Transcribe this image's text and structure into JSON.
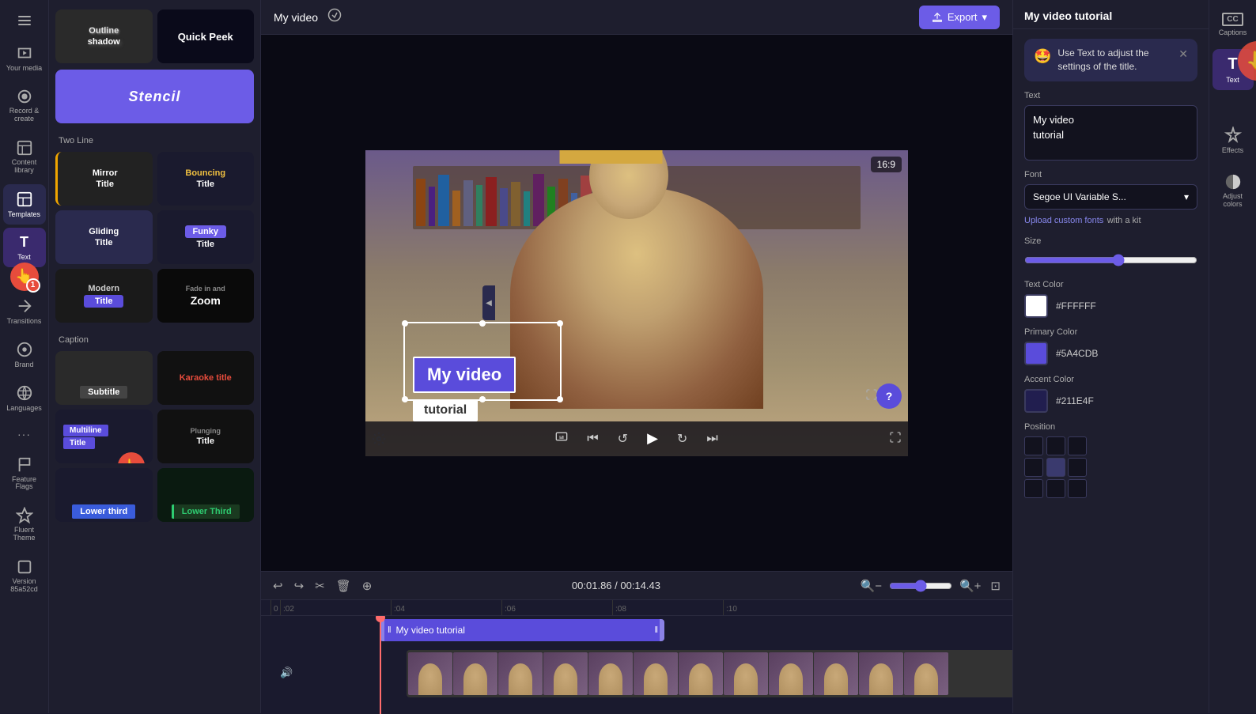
{
  "sidebar": {
    "items": [
      {
        "id": "menu",
        "label": "",
        "icon": "☰"
      },
      {
        "id": "your-media",
        "label": "Your media",
        "icon": "🎬"
      },
      {
        "id": "record-create",
        "label": "Record &\ncreate",
        "icon": "⏺"
      },
      {
        "id": "content-library",
        "label": "Content library",
        "icon": "📚"
      },
      {
        "id": "templates",
        "label": "Templates",
        "icon": "📋",
        "active": true
      },
      {
        "id": "text",
        "label": "Text",
        "icon": "T"
      },
      {
        "id": "transitions",
        "label": "Transitions",
        "icon": "✦"
      },
      {
        "id": "brand",
        "label": "Brand",
        "icon": "🎨"
      },
      {
        "id": "languages",
        "label": "Languages",
        "icon": "🌐"
      },
      {
        "id": "more",
        "label": "...",
        "icon": "···"
      },
      {
        "id": "feature-flags",
        "label": "Feature Flags",
        "icon": "⚑"
      },
      {
        "id": "fluent-theme",
        "label": "Fluent Theme",
        "icon": "🎭"
      },
      {
        "id": "version",
        "label": "Version 85a52cd",
        "icon": "📦"
      }
    ]
  },
  "template_panel": {
    "top_section": {
      "items": [
        {
          "id": "outline-shadow",
          "label": "Outline shadow",
          "bg": "#2a2a2a",
          "text_color": "#fff",
          "border_color": "#888"
        },
        {
          "id": "quick-peek",
          "label": "Quick Peek",
          "bg": "#1a1a3e",
          "text_color": "#fff"
        }
      ]
    },
    "stencil_item": {
      "label": "Stencil",
      "bg": "#6c5ce7",
      "text_color": "#fff"
    },
    "two_line_section": {
      "label": "Two Line",
      "items": [
        {
          "id": "mirror-title",
          "label": "Mirror Title",
          "bg": "#222",
          "text_color": "#fff",
          "accent": "#f0a500"
        },
        {
          "id": "bouncing-title",
          "label": "Bouncing Title",
          "bg": "#1a1a2e",
          "text_color": "#fff"
        },
        {
          "id": "gliding-title",
          "label": "Gliding Title",
          "bg": "#2a2a4e",
          "text_color": "#fff"
        },
        {
          "id": "funky-title",
          "label": "Funky Title",
          "bg": "#6c5ce7",
          "text_color": "#fff"
        },
        {
          "id": "modern-title",
          "label": "Modern Title",
          "bg": "#2a2a4e",
          "text_color": "#fff"
        },
        {
          "id": "fade-zoom",
          "label": "Fade in and Zoom",
          "bg": "#1a1a1a",
          "text_color": "#fff"
        }
      ]
    },
    "caption_section": {
      "label": "Caption",
      "items": [
        {
          "id": "subtitle",
          "label": "Subtitle",
          "bg": "#2a2a2a",
          "text_color": "#fff"
        },
        {
          "id": "karaoke-title",
          "label": "Karaoke title",
          "bg": "#1a1a1a",
          "text_color": "#e74c3c"
        },
        {
          "id": "multiline-title",
          "label": "Multiline Title",
          "bg": "#5a4cdb",
          "text_color": "#fff"
        },
        {
          "id": "plunging-title",
          "label": "Plunging Title",
          "bg": "#1a1a1a",
          "text_color": "#fff"
        },
        {
          "id": "lower-third",
          "label": "Lower third",
          "bg": "#3a5cdb",
          "text_color": "#fff"
        },
        {
          "id": "lower-third-2",
          "label": "Lower Third",
          "bg": "#1a3a2e",
          "text_color": "#2ecc71"
        }
      ]
    }
  },
  "top_bar": {
    "project_name": "My video",
    "export_label": "Export"
  },
  "video_preview": {
    "aspect_ratio": "16:9",
    "overlay_title": "My video",
    "overlay_subtitle": "tutorial",
    "time_display": "00:01.86 / 00:14.43"
  },
  "right_panel": {
    "title": "My video tutorial",
    "hint": {
      "emoji": "🤩",
      "text": "Use Text to adjust the settings of the title."
    },
    "text_label": "Text",
    "text_value_line1": "My video",
    "text_value_line2": "tutorial",
    "font_label": "Font",
    "font_value": "Segoe UI Variable S...",
    "upload_fonts_text": "Upload custom fonts",
    "upload_fonts_suffix": " with a kit",
    "size_label": "Size",
    "text_color_label": "Text Color",
    "text_color_value": "#FFFFFF",
    "primary_color_label": "Primary Color",
    "primary_color_value": "#5A4CDB",
    "accent_color_label": "Accent Color",
    "accent_color_value": "#211E4F",
    "position_label": "Position"
  },
  "right_tools": {
    "items": [
      {
        "id": "captions",
        "label": "Captions",
        "icon": "CC"
      },
      {
        "id": "text-tool",
        "label": "Text",
        "icon": "T"
      },
      {
        "id": "effects",
        "label": "Effects",
        "icon": "✦"
      },
      {
        "id": "adjust-colors",
        "label": "Adjust colors",
        "icon": "◐"
      }
    ]
  },
  "timeline": {
    "time_display": "00:01.86 / 00:14.43",
    "clip_label": "My video tutorial",
    "ruler_marks": [
      "0",
      ":02",
      ":04",
      ":06",
      ":08",
      ":10"
    ]
  }
}
